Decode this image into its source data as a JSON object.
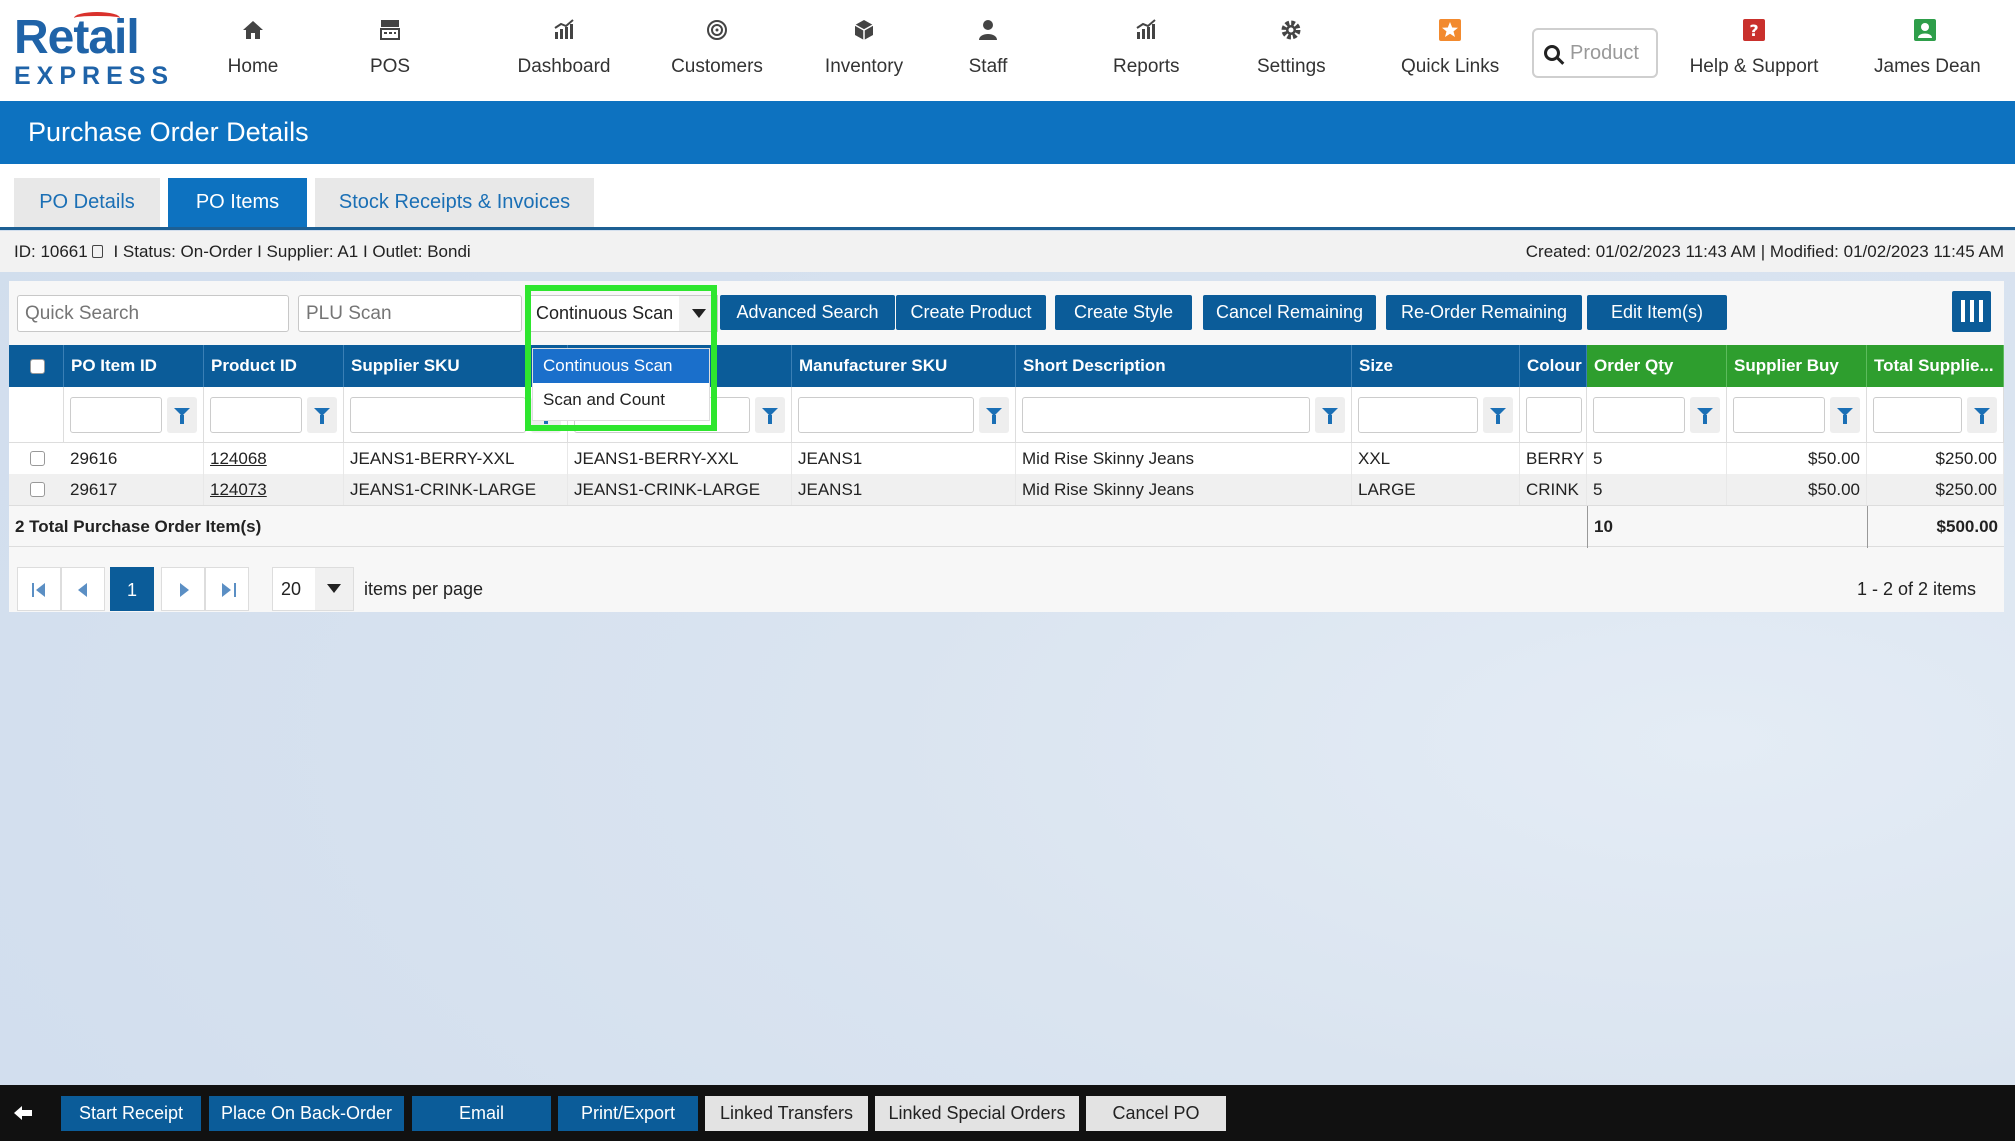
{
  "logo": {
    "line1": "Retail",
    "line2": "EXPRESS"
  },
  "nav": {
    "items": [
      {
        "label": "Home",
        "icon": "home-icon"
      },
      {
        "label": "POS",
        "icon": "register-icon"
      },
      {
        "label": "Dashboard",
        "icon": "bar-chart-icon"
      },
      {
        "label": "Customers",
        "icon": "target-icon"
      },
      {
        "label": "Inventory",
        "icon": "box-icon"
      },
      {
        "label": "Staff",
        "icon": "person-icon"
      },
      {
        "label": "Reports",
        "icon": "bar-chart-icon"
      },
      {
        "label": "Settings",
        "icon": "gear-icon"
      },
      {
        "label": "Quick Links",
        "icon": "star-icon"
      },
      {
        "label": "Help & Support",
        "icon": "question-icon"
      },
      {
        "label": "James Dean",
        "icon": "user-icon"
      }
    ],
    "search_placeholder": "Product"
  },
  "page_title": "Purchase Order Details",
  "tabs": [
    {
      "label": "PO Details",
      "active": false
    },
    {
      "label": "PO Items",
      "active": true
    },
    {
      "label": "Stock Receipts & Invoices",
      "active": false
    }
  ],
  "info": {
    "id": "ID: 10661",
    "status": "I Status: On-Order",
    "supplier": "I Supplier: A1",
    "outlet": "I Outlet: Bondi",
    "dates": "Created: 01/02/2023 11:43 AM | Modified: 01/02/2023 11:45 AM"
  },
  "toolbar": {
    "quick_search": "Quick Search",
    "plu_scan": "PLU Scan",
    "scan_mode": "Continuous Scan",
    "scan_options": [
      "Continuous Scan",
      "Scan and Count"
    ],
    "buttons": [
      "Advanced Search",
      "Create Product",
      "Create Style",
      "Cancel Remaining",
      "Re-Order Remaining",
      "Edit Item(s)"
    ]
  },
  "grid": {
    "columns": [
      "PO Item ID",
      "Product ID",
      "Supplier SKU",
      "",
      "Manufacturer SKU",
      "Short Description",
      "Size",
      "Colour",
      "Order Qty",
      "Supplier Buy",
      "Total Supplie..."
    ],
    "rows": [
      [
        "29616",
        "124068",
        "JEANS1-BERRY-XXL",
        "JEANS1-BERRY-XXL",
        "JEANS1",
        "Mid Rise Skinny Jeans",
        "XXL",
        "BERRY",
        "5",
        "$50.00",
        "$250.00"
      ],
      [
        "29617",
        "124073",
        "JEANS1-CRINK-LARGE",
        "JEANS1-CRINK-LARGE",
        "JEANS1",
        "Mid Rise Skinny Jeans",
        "LARGE",
        "CRINK",
        "5",
        "$50.00",
        "$250.00"
      ]
    ],
    "totals": {
      "label": "2 Total Purchase Order Item(s)",
      "order_qty": "10",
      "total": "$500.00"
    }
  },
  "pager": {
    "current_page": "1",
    "per_page": "20",
    "per_page_label": "items per page",
    "summary": "1 - 2 of 2 items"
  },
  "bottom": {
    "buttons": [
      {
        "label": "Start Receipt",
        "style": "blue"
      },
      {
        "label": "Place On Back-Order",
        "style": "blue"
      },
      {
        "label": "Email",
        "style": "blue"
      },
      {
        "label": "Print/Export",
        "style": "blue"
      },
      {
        "label": "Linked Transfers",
        "style": "grey"
      },
      {
        "label": "Linked Special Orders",
        "style": "grey"
      },
      {
        "label": "Cancel PO",
        "style": "grey"
      }
    ]
  },
  "colors": {
    "brand_blue": "#0d72c0",
    "dark_blue": "#0b5c99",
    "green_header": "#2e9e2e",
    "highlight": "#2ee62e"
  }
}
